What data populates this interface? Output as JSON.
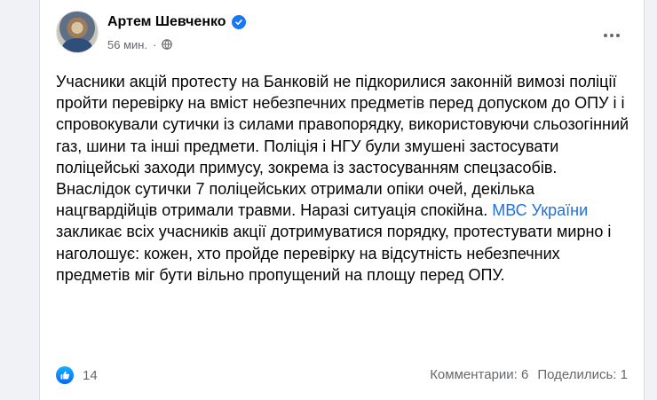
{
  "post": {
    "author": "Артем Шевченко",
    "time": "56 мин.",
    "separator": "·",
    "text_before_link": "Учасники акцій протесту на Банковій не підкорилися законній вимозі поліції пройти перевірку на вміст небезпечних предметів перед допуском до ОПУ і і спровокували сутички із силами правопорядку, використовуючи сльозогінний газ, шини та інші предмети. Поліція і НГУ були змушені застосувати поліцейські заходи примусу, зокрема із застосуванням спецзасобів. Внаслідок сутички 7 поліцейських отримали опіки очей, декілька нацгвардійців отримали травми. Наразі ситуація спокійна. ",
    "link_text": "МВС України",
    "text_after_link": " закликає всіх учасників акції дотримуватися порядку, протестувати мирно і наголошує: кожен, хто пройде перевірку на відсутність небезпечних предметів міг бути вільно пропущений на площу перед ОПУ.",
    "icons": {
      "avatar": "author-avatar",
      "verified": "verified-badge-icon",
      "audience": "globe-icon",
      "more": "more-options-icon",
      "reaction": "like-icon"
    }
  },
  "footer": {
    "reaction_count": "14",
    "comments": "Комментарии: 6",
    "shares": "Поделились: 1"
  },
  "colors": {
    "link": "#216fdb",
    "verified": "#1877f2",
    "secondary_text": "#65676b"
  }
}
